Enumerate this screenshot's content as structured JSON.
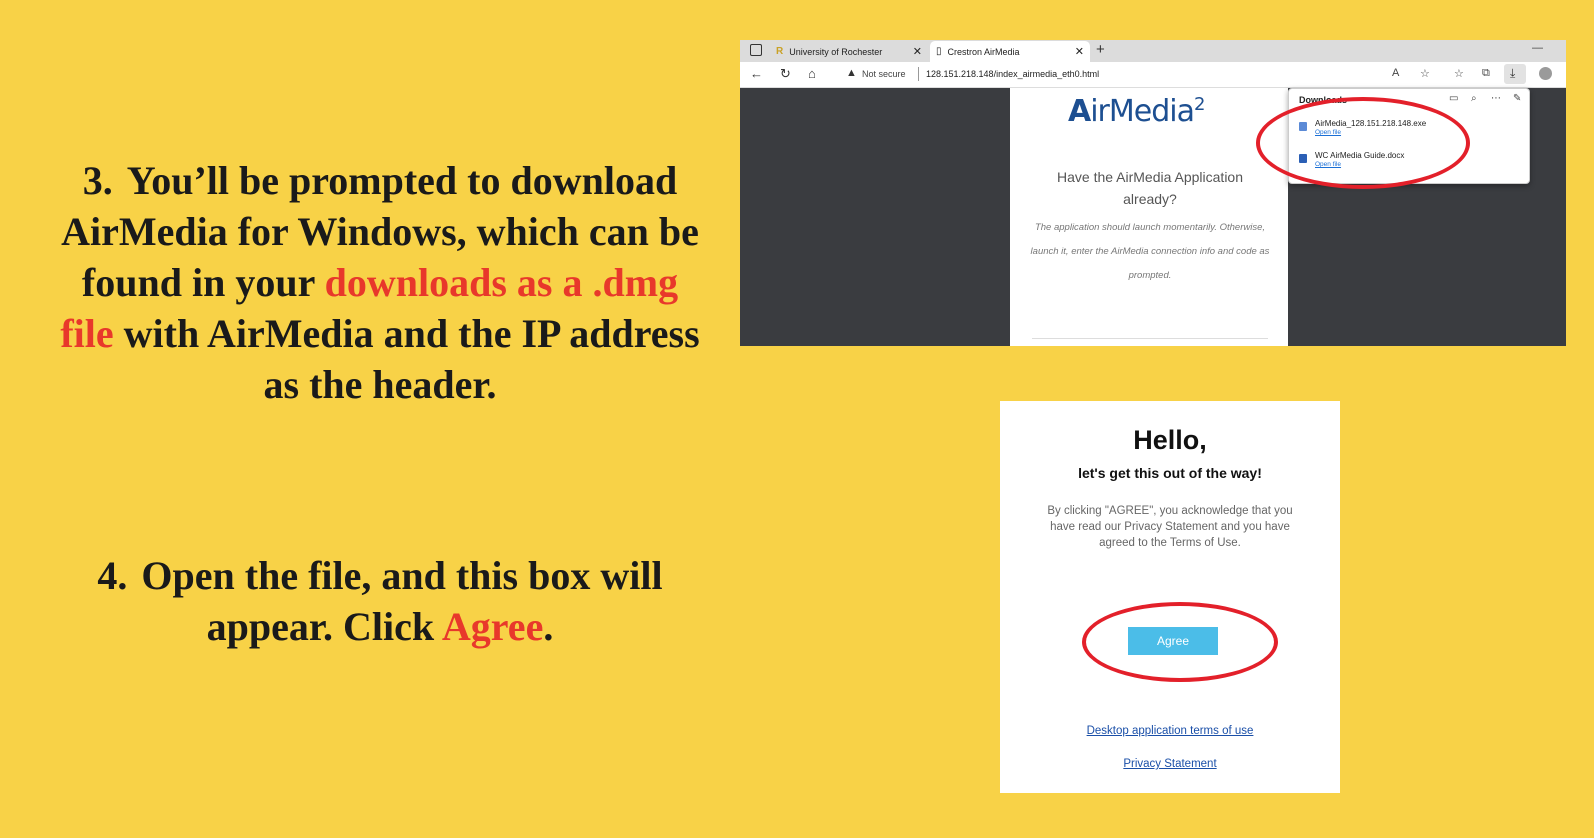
{
  "steps": {
    "step3": {
      "number": "3.",
      "text_before": "You’ll be prompted to download AirMedia for Windows, which can be found in your ",
      "highlight": "downloads as a .dmg file",
      "text_after": " with AirMedia and the IP address as the header."
    },
    "step4": {
      "number": "4.",
      "text_before": "Open the file, and this box will appear. Click ",
      "highlight": "Agree",
      "text_after": "."
    }
  },
  "browser": {
    "tabs": [
      {
        "label": "University of Rochester",
        "icon": "rochester-logo-icon"
      },
      {
        "label": "Crestron AirMedia",
        "icon": "page-icon"
      }
    ],
    "address": {
      "security_label": "Not secure",
      "url": "128.151.218.148/index_airmedia_eth0.html"
    },
    "page": {
      "logo_a": "A",
      "logo_rest": "irMedia",
      "logo_version": "2",
      "heading": "Have the AirMedia Application already?",
      "note": "The application should launch momentarily. Otherwise, launch it, enter the AirMedia connection info and code as prompted."
    },
    "downloads": {
      "title": "Downloads",
      "items": [
        {
          "name": "AirMedia_128.151.218.148.exe",
          "action": "Open file"
        },
        {
          "name": "WC AirMedia Guide.docx",
          "action": "Open file"
        }
      ]
    }
  },
  "dialog": {
    "title": "Hello,",
    "subtitle": "let's get this out of the way!",
    "consent": "By clicking \"AGREE\", you acknowledge that you have read our Privacy Statement and you have agreed to the Terms of Use.",
    "agree_label": "Agree",
    "terms_link": "Desktop application terms of use",
    "privacy_link": "Privacy Statement"
  },
  "colors": {
    "background": "#f8d247",
    "highlight": "#e8382b",
    "ring": "#e3202a",
    "agree_button": "#4bbde8"
  }
}
